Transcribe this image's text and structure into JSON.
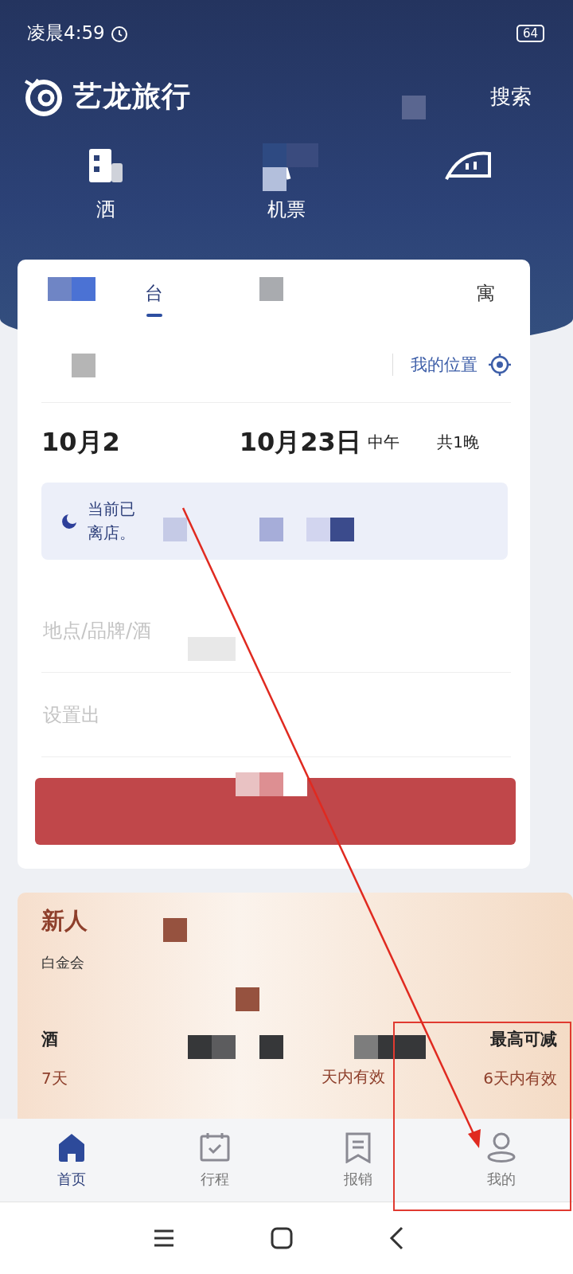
{
  "status_bar": {
    "time": "凌晨4:59",
    "battery": "64"
  },
  "header": {
    "brand": "艺龙旅行",
    "search": "搜索"
  },
  "categories": [
    {
      "kind": "hotel",
      "label": "洒"
    },
    {
      "kind": "flight",
      "label": "机票"
    },
    {
      "kind": "train"
    }
  ],
  "booking": {
    "tabs": [
      {
        "label": "台",
        "selected": true
      },
      {
        "label": "寓",
        "selected": false
      }
    ],
    "location": {
      "my_location": "我的位置"
    },
    "dates": {
      "check_in": "10月2",
      "check_out": "10月23日",
      "check_out_note": "中午",
      "nights": "共1晚"
    },
    "notice": {
      "line_1": "当前已",
      "line_2": "离店。"
    },
    "fields": [
      {
        "placeholder": "地点/品牌/酒"
      },
      {
        "placeholder": "设置出"
      }
    ]
  },
  "promo": {
    "title": "新人",
    "badge": "白金会",
    "items": [
      {
        "name": "酒",
        "validity": "7天"
      },
      {
        "validity": "天内有效"
      },
      {
        "name": "最高可减",
        "validity": "6天内有效"
      }
    ]
  },
  "bottom_nav": [
    {
      "kind": "home",
      "label": "首页",
      "selected": true
    },
    {
      "kind": "trips",
      "label": "行程",
      "selected": false
    },
    {
      "kind": "expense",
      "label": "报销",
      "selected": false
    },
    {
      "kind": "profile",
      "label": "我的",
      "selected": false
    }
  ]
}
